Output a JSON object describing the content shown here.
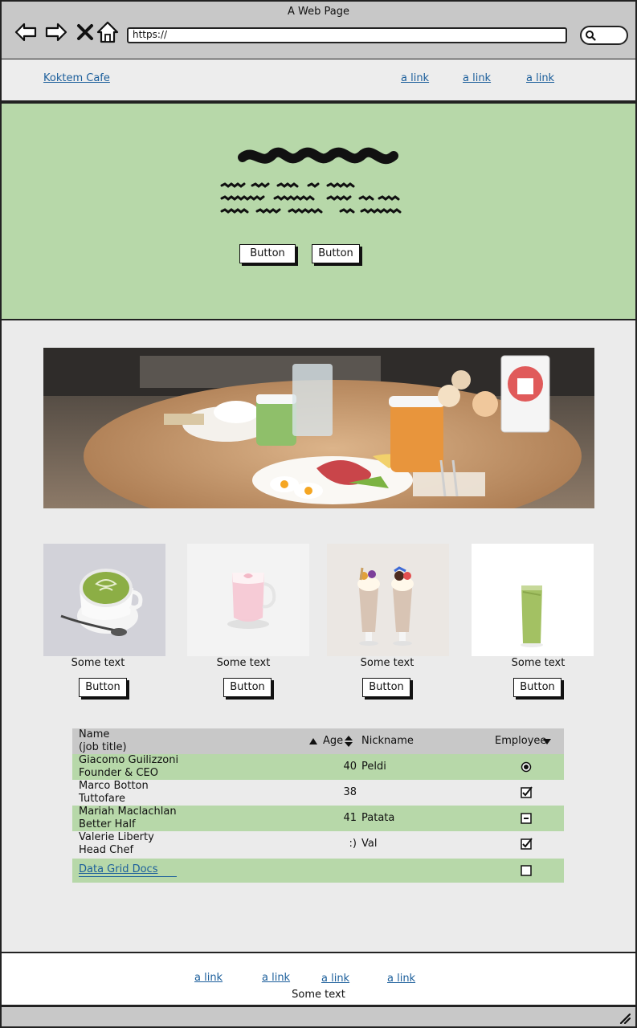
{
  "browser": {
    "window_title": "A Web Page",
    "url": "https://"
  },
  "topnav": {
    "brand": "Koktem Cafe",
    "links": [
      "a link",
      "a link",
      "a link"
    ]
  },
  "hero": {
    "buttons": [
      "Button",
      "Button"
    ]
  },
  "cards": [
    {
      "caption": "Some text",
      "button": "Button"
    },
    {
      "caption": "Some text",
      "button": "Button"
    },
    {
      "caption": "Some text",
      "button": "Button"
    },
    {
      "caption": "Some text",
      "button": "Button"
    }
  ],
  "grid": {
    "headers": {
      "name": "Name",
      "name_sub": "(job title)",
      "age": "Age",
      "nickname": "Nickname",
      "employee": "Employee"
    },
    "rows": [
      {
        "name": "Giacomo Guilizzoni",
        "title": "Founder & CEO",
        "age": "40",
        "nickname": "Peldi",
        "employee": "radio-selected"
      },
      {
        "name": "Marco Botton",
        "title": "Tuttofare",
        "age": "38",
        "nickname": "",
        "employee": "checked"
      },
      {
        "name": "Mariah Maclachlan",
        "title": "Better Half",
        "age": "41",
        "nickname": "Patata",
        "employee": "indeterminate"
      },
      {
        "name": "Valerie Liberty",
        "title": "Head Chef",
        "age": ":)",
        "nickname": "Val",
        "employee": "checked"
      }
    ],
    "footer_link": "Data Grid Docs"
  },
  "footer": {
    "links": [
      "a link",
      "a link",
      "a link",
      "a link"
    ],
    "text": "Some text"
  },
  "colors": {
    "accent_green": "#b7d8a9",
    "link_blue": "#1b5e9b",
    "chrome_gray": "#c8c8c8"
  }
}
